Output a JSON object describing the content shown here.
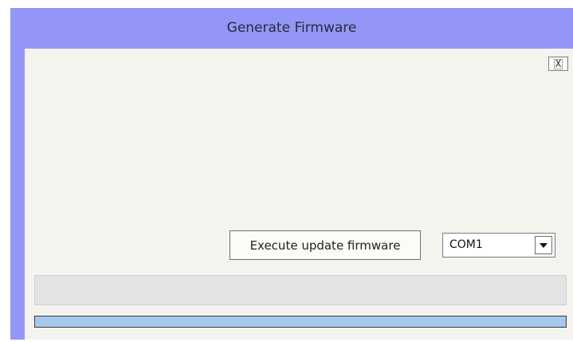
{
  "window": {
    "title": "Generate Firmware"
  },
  "close_button": {
    "label": "X",
    "icon": "close-icon"
  },
  "execute_button": {
    "label": "Execute update firmware"
  },
  "port_select": {
    "value": "COM1",
    "icon": "dropdown-arrow-icon"
  },
  "status": {
    "text": ""
  },
  "progress": {
    "percent": 100,
    "fill_color": "#a7c8ee"
  },
  "colors": {
    "title_bar": "#9396f7",
    "client_background": "#f4f3ee"
  }
}
